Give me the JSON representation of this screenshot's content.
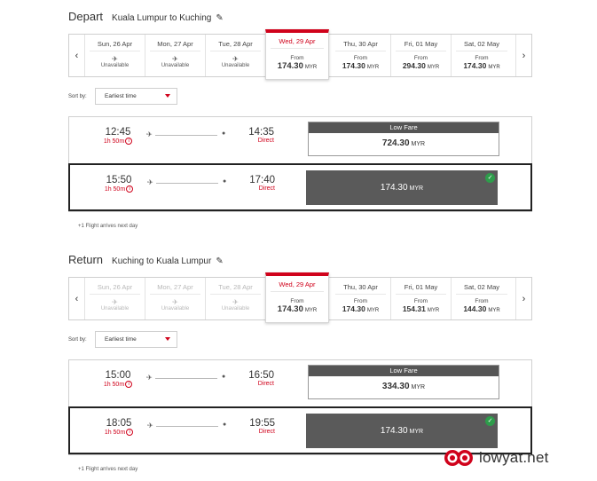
{
  "depart": {
    "heading": "Depart",
    "route": "Kuala Lumpur to Kuching",
    "edit_icon": "pencil-icon",
    "days": [
      {
        "label": "Sun, 26 Apr",
        "status": "unavailable",
        "unavailable_text": "Unavailable",
        "dim": false
      },
      {
        "label": "Mon, 27 Apr",
        "status": "unavailable",
        "unavailable_text": "Unavailable",
        "dim": false
      },
      {
        "label": "Tue, 28 Apr",
        "status": "unavailable",
        "unavailable_text": "Unavailable",
        "dim": false
      },
      {
        "label": "Wed, 29 Apr",
        "status": "price",
        "from": "From",
        "price": "174.30",
        "currency": "MYR",
        "selected": true
      },
      {
        "label": "Thu, 30 Apr",
        "status": "price",
        "from": "From",
        "price": "174.30",
        "currency": "MYR"
      },
      {
        "label": "Fri, 01 May",
        "status": "price",
        "from": "From",
        "price": "294.30",
        "currency": "MYR"
      },
      {
        "label": "Sat, 02 May",
        "status": "price",
        "from": "From",
        "price": "174.30",
        "currency": "MYR"
      }
    ],
    "sort_label": "Sort by:",
    "sort_value": "Earliest time",
    "flights": [
      {
        "dep_time": "12:45",
        "duration": "1h 50m",
        "arr_time": "14:35",
        "stops": "Direct",
        "fare_header": "Low Fare",
        "fare": "724.30",
        "currency": "MYR",
        "selected": false
      },
      {
        "dep_time": "15:50",
        "duration": "1h 50m",
        "arr_time": "17:40",
        "stops": "Direct",
        "fare": "174.30",
        "currency": "MYR",
        "selected": true
      }
    ],
    "note": "+1 Flight arrives next day"
  },
  "return": {
    "heading": "Return",
    "route": "Kuching to Kuala Lumpur",
    "edit_icon": "pencil-icon",
    "days": [
      {
        "label": "Sun, 26 Apr",
        "status": "unavailable",
        "unavailable_text": "Unavailable",
        "dim": true
      },
      {
        "label": "Mon, 27 Apr",
        "status": "unavailable",
        "unavailable_text": "Unavailable",
        "dim": true
      },
      {
        "label": "Tue, 28 Apr",
        "status": "unavailable",
        "unavailable_text": "Unavailable",
        "dim": true
      },
      {
        "label": "Wed, 29 Apr",
        "status": "price",
        "from": "From",
        "price": "174.30",
        "currency": "MYR",
        "selected": true
      },
      {
        "label": "Thu, 30 Apr",
        "status": "price",
        "from": "From",
        "price": "174.30",
        "currency": "MYR"
      },
      {
        "label": "Fri, 01 May",
        "status": "price",
        "from": "From",
        "price": "154.31",
        "currency": "MYR"
      },
      {
        "label": "Sat, 02 May",
        "status": "price",
        "from": "From",
        "price": "144.30",
        "currency": "MYR"
      }
    ],
    "sort_label": "Sort by:",
    "sort_value": "Earliest time",
    "flights": [
      {
        "dep_time": "15:00",
        "duration": "1h 50m",
        "arr_time": "16:50",
        "stops": "Direct",
        "fare_header": "Low Fare",
        "fare": "334.30",
        "currency": "MYR",
        "selected": false
      },
      {
        "dep_time": "18:05",
        "duration": "1h 50m",
        "arr_time": "19:55",
        "stops": "Direct",
        "fare": "174.30",
        "currency": "MYR",
        "selected": true
      }
    ],
    "note": "+1 Flight arrives next day"
  },
  "watermark": {
    "text": "lowyat.net",
    "icon": "lowyat-logo-icon"
  },
  "colors": {
    "accent": "#d0021b",
    "selected_fare": "#5a5a5a",
    "check": "#2e9c4b"
  }
}
